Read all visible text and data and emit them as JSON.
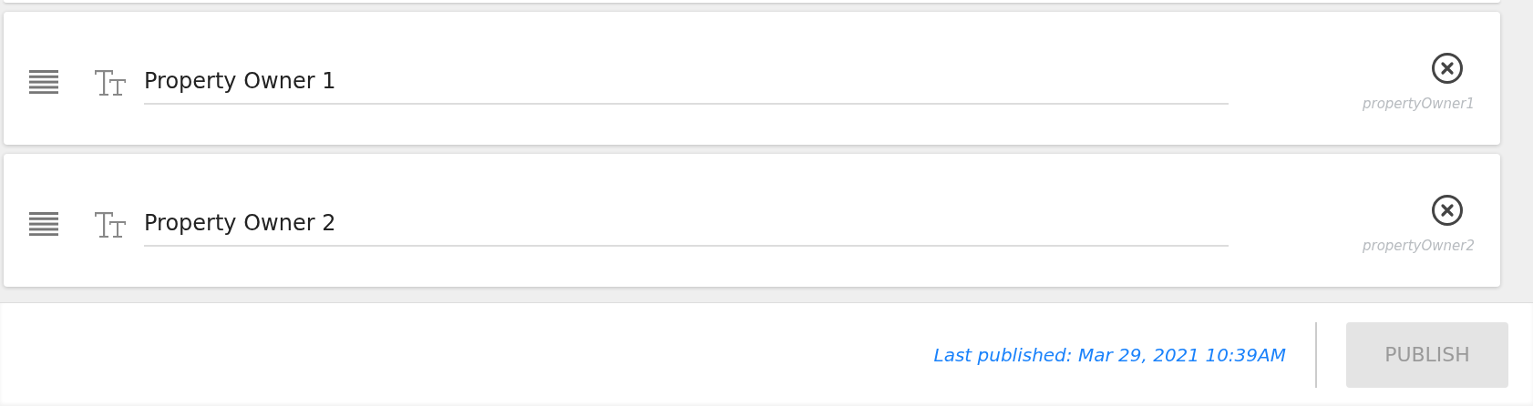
{
  "fields": [
    {
      "label": "Property Owner 1",
      "key": "propertyOwner1"
    },
    {
      "label": "Property Owner 2",
      "key": "propertyOwner2"
    }
  ],
  "footer": {
    "last_published": "Last published: Mar 29, 2021 10:39AM",
    "publish_button": {
      "label": "PUBLISH",
      "disabled": true
    }
  }
}
